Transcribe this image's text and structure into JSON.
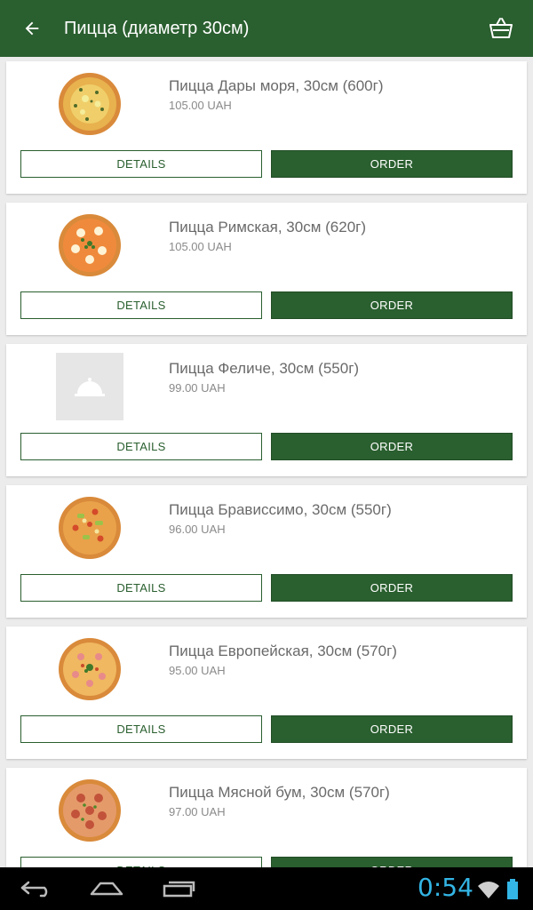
{
  "appbar": {
    "title": "Пицца (диаметр 30см)",
    "back_icon": "arrow-left-icon",
    "cart_icon": "basket-icon",
    "color": "#2a5f2f"
  },
  "products": [
    {
      "name": "Пицца Дары моря, 30см (600г)",
      "price": "105.00 UAH",
      "image": "pizza-seafood",
      "details_label": "DETAILS",
      "order_label": "ORDER"
    },
    {
      "name": "Пицца Римская, 30см (620г)",
      "price": "105.00 UAH",
      "image": "pizza-roman",
      "details_label": "DETAILS",
      "order_label": "ORDER"
    },
    {
      "name": "Пицца Феличе, 30см (550г)",
      "price": "99.00 UAH",
      "image": "placeholder-cloche-icon",
      "details_label": "DETAILS",
      "order_label": "ORDER"
    },
    {
      "name": "Пицца Брависсимо, 30см (550г)",
      "price": "96.00 UAH",
      "image": "pizza-bravissimo",
      "details_label": "DETAILS",
      "order_label": "ORDER"
    },
    {
      "name": "Пицца Европейская, 30см (570г)",
      "price": "95.00 UAH",
      "image": "pizza-european",
      "details_label": "DETAILS",
      "order_label": "ORDER"
    },
    {
      "name": "Пицца Мясной бум, 30см (570г)",
      "price": "97.00 UAH",
      "image": "pizza-meat",
      "details_label": "DETAILS",
      "order_label": "ORDER"
    }
  ],
  "system_bar": {
    "time": "0:54",
    "clock_color": "#33b5e5"
  }
}
